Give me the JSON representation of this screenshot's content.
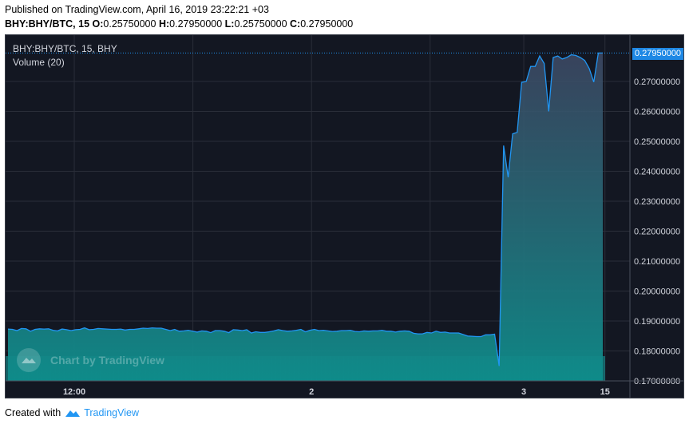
{
  "header": {
    "published": "Published on TradingView.com, April 16, 2019 23:22:21 +03",
    "symbol": "BHY:BHY/BTC, 15",
    "o_label": "O:",
    "o_value": "0.25750000",
    "h_label": "H:",
    "h_value": "0.27950000",
    "l_label": "L:",
    "l_value": "0.25750000",
    "c_label": "C:",
    "c_value": "0.27950000"
  },
  "legend": {
    "symbol": "BHY:BHY/BTC, 15, BHY",
    "volume": "Volume (20)"
  },
  "watermark": {
    "text": "Chart by TradingView"
  },
  "price_tag": "0.27950000",
  "footer": {
    "created": "Created with",
    "brand": "TradingView"
  },
  "colors": {
    "background": "#131722",
    "grid": "#2a2e39",
    "line": "#2196f3",
    "area_top": "#3f4a66",
    "area_bottom": "#0e8d8b",
    "volume": "#14a3a0",
    "axis_text": "#d1d4dc",
    "price_tag": "#1e88e5"
  },
  "chart_data": {
    "type": "area",
    "symbol": "BHY/BTC",
    "interval": "15",
    "ylim": [
      0.17,
      0.28
    ],
    "y_ticks": [
      "0.27000000",
      "0.26000000",
      "0.25000000",
      "0.24000000",
      "0.23000000",
      "0.22000000",
      "0.21000000",
      "0.20000000",
      "0.19000000",
      "0.18000000",
      "0.17000000"
    ],
    "y_tick_values": [
      0.27,
      0.26,
      0.25,
      0.24,
      0.23,
      0.22,
      0.21,
      0.2,
      0.19,
      0.18,
      0.17
    ],
    "x_ticks": [
      "12:00",
      "",
      "2",
      "",
      "3",
      "15"
    ],
    "x_tick_positions": [
      0.11,
      0.3,
      0.49,
      0.68,
      0.83,
      0.96
    ],
    "last_price": 0.2795,
    "grid": true,
    "series": [
      {
        "values": [
          0.1873,
          0.1872,
          0.1868,
          0.1875,
          0.1874,
          0.1866,
          0.1872,
          0.1874,
          0.1873,
          0.1874,
          0.1869,
          0.1867,
          0.1873,
          0.1871,
          0.1868,
          0.1871,
          0.1872,
          0.1877,
          0.1871,
          0.1872,
          0.1875,
          0.1874,
          0.1873,
          0.1872,
          0.1872,
          0.1873,
          0.187,
          0.1872,
          0.1872,
          0.1874,
          0.1876,
          0.1875,
          0.1877,
          0.1876,
          0.1876,
          0.1872,
          0.1868,
          0.1872,
          0.1866,
          0.1867,
          0.1869,
          0.1866,
          0.1863,
          0.1867,
          0.1866,
          0.1861,
          0.1868,
          0.1868,
          0.1866,
          0.1861,
          0.1871,
          0.187,
          0.1868,
          0.1871,
          0.186,
          0.1864,
          0.1862,
          0.1862,
          0.1864,
          0.1867,
          0.1871,
          0.1868,
          0.1866,
          0.1867,
          0.1869,
          0.1872,
          0.1864,
          0.1869,
          0.1872,
          0.1868,
          0.1869,
          0.1867,
          0.1865,
          0.1866,
          0.1868,
          0.1868,
          0.1869,
          0.1865,
          0.1864,
          0.1867,
          0.1866,
          0.1867,
          0.1867,
          0.1869,
          0.1866,
          0.1866,
          0.1863,
          0.1866,
          0.1867,
          0.1866,
          0.1859,
          0.1857,
          0.1857,
          0.1862,
          0.186,
          0.1866,
          0.1862,
          0.1863,
          0.186,
          0.186,
          0.186,
          0.1855,
          0.185,
          0.1849,
          0.1848,
          0.1848,
          0.1854,
          0.1854,
          0.1856,
          0.175,
          0.2486,
          0.238,
          0.2525,
          0.253,
          0.2697,
          0.27,
          0.275,
          0.275,
          0.2785,
          0.276,
          0.26,
          0.278,
          0.2785,
          0.2775,
          0.278,
          0.2789,
          0.2787,
          0.278,
          0.277,
          0.2743,
          0.2698,
          0.2795,
          0.2795
        ]
      }
    ]
  }
}
